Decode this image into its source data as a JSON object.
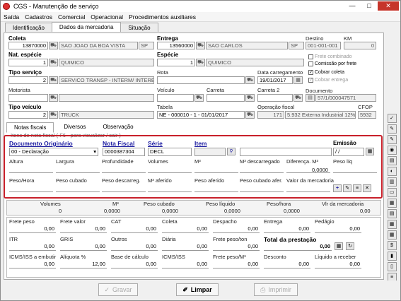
{
  "window": {
    "title": "CGS - Manutenção de serviço",
    "min": "—",
    "max": "□",
    "close": "✕"
  },
  "menu": [
    "Saída",
    "Cadastros",
    "Comercial",
    "Operacional",
    "Procedimentos auxiliares"
  ],
  "tabs": [
    "Identificação",
    "Dados da mercadoria",
    "Situação"
  ],
  "top": {
    "coleta": {
      "label": "Coleta",
      "code": "13870000",
      "city": "SAO JOAO DA BOA VISTA",
      "uf": "SP"
    },
    "entrega": {
      "label": "Entrega",
      "code": "13560000",
      "city": "SAO CARLOS",
      "uf": "SP"
    },
    "destino": {
      "label": "Destino",
      "value": "001-001-001"
    },
    "km": {
      "label": "KM",
      "value": "0"
    },
    "nat_especie": {
      "label": "Nat. espécie",
      "code": "1",
      "desc": "QUIMICO"
    },
    "especie": {
      "label": "Espécie",
      "code": "1",
      "desc": "QUIMICO"
    },
    "frete_combinado": "Frete combinado",
    "comissao_por_frete": "Comissão por frete",
    "tipo_servico": {
      "label": "Tipo serviço",
      "code": "2",
      "desc": "SERVICO TRANSP - INTERM/ INTERES"
    },
    "rota": {
      "label": "Rota"
    },
    "data_carregamento": {
      "label": "Data carregamento",
      "value": "19/01/2017"
    },
    "cobrar_coleta": "Cobrar coleta",
    "cobrar_entrega": "Cobrar entrega",
    "motorista": {
      "label": "Motorista"
    },
    "veiculo": {
      "label": "Veículo"
    },
    "carreta": {
      "label": "Carreta"
    },
    "carreta2": {
      "label": "Carreta 2"
    },
    "documento": {
      "label": "Documento",
      "value": "57/1/000047571"
    },
    "tipo_veiculo": {
      "label": "Tipo veículo",
      "code": "2",
      "desc": "TRUCK"
    },
    "tabela": {
      "label": "Tabela",
      "value": "NE - 000010 - 1 - 01/01/2017"
    },
    "operacao_fiscal": {
      "label": "Operação fiscal",
      "code": "171",
      "desc": "5.932 Externa Industrial 12%"
    },
    "cfop": {
      "label": "CFOP",
      "value": "5932"
    }
  },
  "subtabs": [
    "Notas fiscais",
    "Diversos",
    "Observação"
  ],
  "nf": {
    "caption": "Itens de nota fiscal ( F6 - para visualizar / sair )",
    "doc_origin_label": "Documento Originário",
    "doc_origin_value": "00 - Declaração",
    "nota_fiscal_label": "Nota Fiscal",
    "nota_fiscal_value": "0000387304",
    "serie_label": "Série",
    "serie_value": "DECL",
    "item_label": "Item",
    "emissao_label": "Emissão",
    "emissao_value": "/ /",
    "row2": [
      "Altura",
      "Largura",
      "Profundidade",
      "Volumes",
      "M³",
      "M³ descarregado",
      "Diferença. M³",
      "Peso líq"
    ],
    "diferenca_value": "0,0000",
    "row3": [
      "Peso/Hora",
      "Peso cubado",
      "Peso descarreg.",
      "M³ aferido",
      "Peso aferido",
      "Peso cubado afer.",
      "Valor da mercadoria"
    ]
  },
  "totals": {
    "headers": [
      "Volumes",
      "M³",
      "Peso cubado",
      "Peso líquido",
      "Peso/hora",
      "Vlr da mercadoria"
    ],
    "values": [
      "0",
      "0,0000",
      "0,0000",
      "0,0000",
      "0,0000",
      "0,00"
    ]
  },
  "freight": {
    "row1_labels": [
      "Frete peso",
      "Frete valor",
      "CAT",
      "Coleta",
      "Despacho",
      "Entrega",
      "Pedágio"
    ],
    "row1_values": [
      "0,00",
      "0,00",
      "0,00",
      "0,00",
      "0,00",
      "0,00",
      "0,00"
    ],
    "row2_labels": [
      "ITR",
      "GRIS",
      "Outros",
      "Diária",
      "Frete peso/ton",
      "Total da prestação"
    ],
    "row2_values": [
      "0,00",
      "0,00",
      "0,00",
      "0,00",
      "0,00",
      "0,00"
    ],
    "row3_labels": [
      "ICMS/ISS a embutir",
      "Alíquota %",
      "Base de cálculo",
      "ICMS/ISS",
      "Frete peso/M³",
      "Desconto",
      "Líquido a receber"
    ],
    "row3_values": [
      "0,00",
      "12,00",
      "0,00",
      "0,00",
      "0,00",
      "0,00",
      "0,00"
    ]
  },
  "buttons": {
    "gravar": "Gravar",
    "limpar": "Limpar",
    "imprimir": "Imprimir"
  }
}
